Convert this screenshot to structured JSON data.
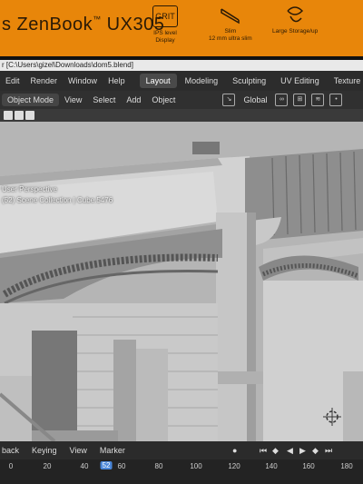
{
  "sticker": {
    "brand": "s ZenBook",
    "brand_tm": "™",
    "model": "UX305",
    "badges": [
      {
        "icon": "GRIT",
        "caption": "IPS level\nDisplay"
      },
      {
        "icon": "",
        "caption": "Slim\n12 mm ultra slim"
      },
      {
        "icon": "",
        "caption": "Large Storage/up"
      }
    ]
  },
  "window": {
    "title": "r [C:\\Users\\gizel\\Downloads\\dom5.blend]"
  },
  "menu": {
    "items": [
      "Edit",
      "Render",
      "Window",
      "Help"
    ],
    "workspaces": [
      "Layout",
      "Modeling",
      "Sculpting",
      "UV Editing",
      "Texture Paint"
    ],
    "active_workspace": "Layout"
  },
  "header": {
    "mode": "Object Mode",
    "items": [
      "View",
      "Select",
      "Add",
      "Object"
    ],
    "transform": "Global"
  },
  "viewport": {
    "perspective": "User Perspective",
    "collection": "(52) Scene Collection | Cube.5476"
  },
  "timeline": {
    "menus": [
      "back",
      "Keying",
      "View",
      "Marker"
    ],
    "ticks": [
      "0",
      "20",
      "40",
      "60",
      "80",
      "100",
      "120",
      "140",
      "160",
      "180"
    ],
    "current_frame": "52"
  },
  "colors": {
    "sticker": "#e8860a",
    "active_frame": "#4a86d8"
  }
}
